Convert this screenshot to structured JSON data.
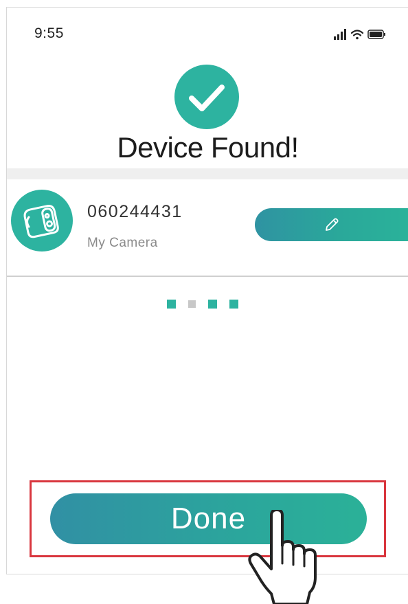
{
  "status_bar": {
    "time": "9:55",
    "icons": [
      "cellular-signal-icon",
      "wifi-icon",
      "battery-icon"
    ]
  },
  "header": {
    "icon": "check-circle-icon",
    "title": "Device Found!"
  },
  "device": {
    "id": "060244431",
    "name": "My Camera",
    "avatar_icon": "camera-icon",
    "edit_icon": "pencil-icon"
  },
  "pagination": {
    "total": 4,
    "active_indices": [
      0,
      2,
      3
    ]
  },
  "done_button": {
    "label": "Done"
  },
  "annotations": {
    "highlight_color": "#d9363e",
    "pointer_icon": "hand-pointer-icon"
  },
  "colors": {
    "accent": "#2db3a0",
    "gradient_start": "#3190a4",
    "gradient_end": "#2bb198"
  }
}
